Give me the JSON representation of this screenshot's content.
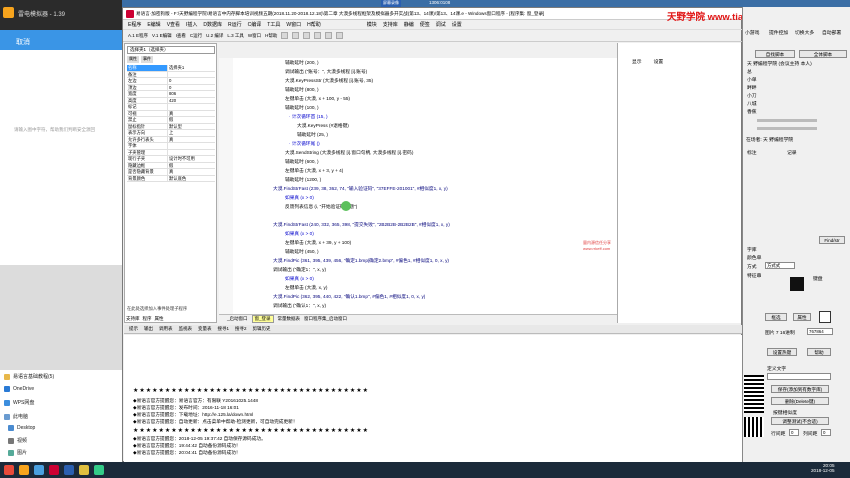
{
  "emulator": {
    "title": "雷电模拟器 - 1.39",
    "cancel": "取消",
    "input_hint": "请输入图中字符，帮助我们判断安全源回",
    "files": [
      {
        "label": "易语言基础教程(5)"
      },
      {
        "label": "OneDrive"
      },
      {
        "label": "WPS网盘"
      },
      {
        "label": "此电脑"
      },
      {
        "label": "Desktop"
      },
      {
        "label": "视频"
      },
      {
        "label": "图片"
      }
    ]
  },
  "ide": {
    "title": "易语言·加密狗版 - F:\\天野编程学院\\易语言中内存脚本培训视频五期(2018.11.20-2018.12.18)\\第二章 大漠多线程框架及模拟器多开实战(第13、14课)\\第13、14课.e - Windows窗口程序 - [程序集: 窗_登录]",
    "menu": [
      "E程序",
      "E编辑",
      "V查看",
      "I插入",
      "D数据库",
      "R运行",
      "C编译",
      "T工具",
      "W窗口",
      "H帮助",
      "模块",
      "支持库",
      "静编",
      "便签",
      "调试",
      "设置"
    ],
    "toolbar": [
      "A.1 E程序",
      "V.1 E编辑",
      "I查看",
      "C运行",
      "U.2 编译",
      "L.3 工具",
      "W窗口",
      "H帮助"
    ],
    "props": {
      "combo": "选择夹1（选择夹）",
      "tabs": [
        "属性",
        "事件"
      ],
      "rows": [
        {
          "k": "名称",
          "v": "选择夹1"
        },
        {
          "k": "备注",
          "v": ""
        },
        {
          "k": "左边",
          "v": "0"
        },
        {
          "k": "顶边",
          "v": "0"
        },
        {
          "k": "宽度",
          "v": "806"
        },
        {
          "k": "高度",
          "v": "420"
        },
        {
          "k": "标记",
          "v": ""
        },
        {
          "k": "可视",
          "v": "真"
        },
        {
          "k": "禁止",
          "v": "假"
        },
        {
          "k": "鼠标指针",
          "v": "默认型"
        },
        {
          "k": "表示方向",
          "v": "上"
        },
        {
          "k": "允许多行表头",
          "v": "真"
        },
        {
          "k": "字体",
          "v": ""
        },
        {
          "k": "子夹管理",
          "v": ""
        },
        {
          "k": "现行子夹",
          "v": "设计时不可用"
        },
        {
          "k": "隐藏边框",
          "v": "假"
        },
        {
          "k": "是否隐藏背景",
          "v": "真"
        },
        {
          "k": "背景颜色",
          "v": "默认底色"
        }
      ],
      "hint": "在此处选择加入事件处理子程序",
      "bottom_tabs": [
        "支持库",
        "程序",
        "属性"
      ]
    },
    "code_lines": [
      "辅助延时 (200, )",
      "调试输出 (\"账号：\", 大漠多线程 [i].账号)",
      "大漠.KeyPressStr (大漠多线程 [i].账号, 35)",
      "辅助延时 (800, )",
      "左键单击 (大漠, x + 100, y - 55)",
      "辅助延时 (100, )",
      "· 计次循环首 (15, )",
      "大漠.KeyPress (#退格键)",
      "辅助延时 (25, )",
      "· 计次循环尾 ()",
      "大漠.SendString (大漠多线程 [i].窗口句柄, 大漠多线程 [i].密码)",
      "辅助延时 (600, )",
      "左键单击 (大漠, x + 3, y + 4)",
      "辅助延时 (1200, )",
      "大漠.FindStrFast (239, 38, 362, 74, \"输入验证码\", \"37EFFE-201001\", #相似度1, x, y)",
      "如果真 (x > 0)",
      "反馈列表信息 (i, \"开始验证码答题\")",
      "",
      "大漠.FindStrFast (240, 332, 365, 398, \"提交失败\", \"2B2B2B-2B2B2B\", #相似度1, x, y)",
      "如果真 (x > 0)",
      "左键单击 (大漠, x + 39, y + 100)",
      "辅助延时 (450, )",
      "大漠.FindPic (361, 395, 439, 456, \"确定1.bmp|确定2.bmp\", #偏色1, #相似度1, 0, x, y)",
      "调试输出 (\"确定1：\", x, y)",
      "如果真 (x > 0)",
      "左键单击 (大漠, x, y)",
      "大漠.FindPic (362, 395, 440, 422, \"确认1.bmp\", #偏色1, #相似度1, 0, x, y)",
      "调试输出 (\"确认1：\", x, y)"
    ],
    "code_tabs": [
      "_启动窗口",
      "窗_登录",
      "常量数据表",
      "窗口程序集_启动窗口"
    ],
    "watermark": [
      "量内源信任分享",
      "www.rrkeff.com"
    ],
    "right_head": [
      "显示",
      "设置"
    ],
    "output_tabs": [
      "提示",
      "输出",
      "调用表",
      "监视表",
      "变量表",
      "搜寻1",
      "搜寻2",
      "剪辑历史"
    ],
    "stars": "★★★★★★★★★★★★★★★★★★★★★★★★★★★★★★★★★★★★★",
    "output_lines_a": [
      "◆易语言官方提醒您：易语言官方：有限联 Y20161025.1448",
      "◆易语言官方提醒您：发布时间：2016-11-18 16:01",
      "◆易语言官方提醒您：下载地址：http://e.125.la/down.html",
      "◆易语言官方提醒您：自动更新：点击菜单中帮助-检测更新，可自动完成更新！"
    ],
    "output_lines_b": [
      "◆易语言官方提醒您：2018-12-05 19:37:42 自动保存源码成功。",
      "◆易语言官方提醒您：19:44:42 自动备份源码成功！",
      "◆易语言官方提醒您：20:04:41 自动备份源码成功！"
    ]
  },
  "top": {
    "brand": "天野学院 www.tianyebiancheng.com",
    "rec": "屏幕录像",
    "rec_time": "1306:0108"
  },
  "right_tool": {
    "top_items": [
      "小游戏",
      "提件控加",
      "切换大多",
      "自动部署"
    ],
    "btn1": "自找脚本",
    "btn2": "全体脚本",
    "list": [
      "天 野编程学院 (会议主持 本人)",
      "总",
      "小单",
      "畔畔",
      "小刀",
      "八城",
      "香蕉"
    ],
    "host": "在场者: 天 野编程学院",
    "label_users": "标注",
    "label_record": "记录",
    "find": "Find/str",
    "str_label": "字库",
    "color_label": "颜色单",
    "mode_label": "方式",
    "mode_val": "方式式",
    "feature": "特征串",
    "kb": "键盘",
    "preview_btn": "框选",
    "prop_btn": "属性",
    "hex_label": "图片 7 16进制",
    "hex_val": "767864",
    "replace_btn": "设置热键",
    "help_btn": "帮助",
    "define_label": "定义文字",
    "save_btn": "保存(添加到有数字库)",
    "delete_btn": "删除(Delete键)",
    "check_label": "按键相似度",
    "apply_btn": "调整测试(不合适)",
    "row_label": "行间距",
    "col_label": "列间距",
    "v0": "0",
    "v1": "0",
    "clock_time": "20:05",
    "clock_date": "2018-12-05"
  }
}
